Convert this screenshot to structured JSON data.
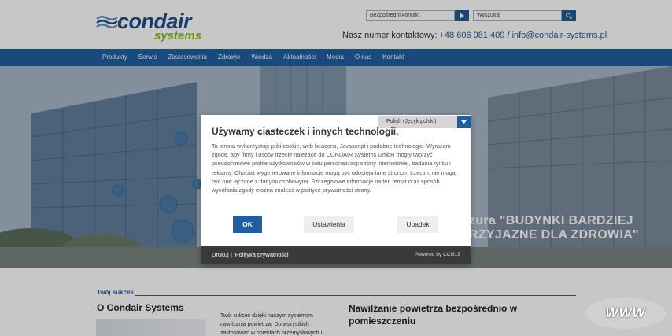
{
  "header": {
    "logo_word": "condair",
    "logo_sub": "systems",
    "direct_contact_placeholder": "Bezpośredni kontakt",
    "search_placeholder": "Wyszukaj",
    "contact_label": "Nasz numer kontaktowy: ",
    "phone": "+48 606 981 409",
    "separator": " / ",
    "email": "info@condair-systems.pl"
  },
  "nav": {
    "items": [
      "Produkty",
      "Serwis",
      "Zastosowania",
      "Zdrowie",
      "Wiedza",
      "Aktualności",
      "Media",
      "O nas",
      "Kontakt"
    ]
  },
  "hero": {
    "caption_line1": "zura \"BUDYNKI BARDZIEJ",
    "caption_line2": "RZYJAZNE DLA ZDROWIA\""
  },
  "cookie_dialog": {
    "title": "Używamy ciasteczek i innych technologii.",
    "language": "Polish (Język polski)",
    "body": "Ta strona wykorzystuje pliki cookie, web beacons, Javascript i podobne technologie. Wyrażam zgodę, aby firmy i osoby trzecie należące do CONDAIR Systems GmbH mogły tworzyć pseudonimowe profile użytkowników w celu personalizacji strony internetowej, badania rynku i reklamy. Chociaż wygenerowane informacje mogą być udostępniane stronom trzecim, nie mogą być one łączone z danymi osobowymi. Szczegółowe informacje na ten temat oraz sposób wycofania zgody można znaleźć w polityce prywatności strony.",
    "ok_label": "OK",
    "settings_label": "Ustawienia",
    "decline_label": "Upadek",
    "footer_print": "Drukuj",
    "footer_sep": "|",
    "footer_privacy": "Polityka prywatności",
    "powered_by": "Powered by CCM19"
  },
  "content": {
    "section_label": "Twój sukces",
    "heading_left": "O Condair Systems",
    "paragraph": "Twój sukces dzięki naszym systemom nawilżania powietrza: Do wszystkich zastosowań w obiektach przemysłowych i",
    "heading_right": "Nawilżanie powietrza bezpośrednio w pomieszczeniu"
  },
  "badge": {
    "text": "WWW"
  },
  "colors": {
    "brand_blue": "#1f5fa0",
    "brand_green": "#8dba2a",
    "footer_dark": "#3a3a3a"
  }
}
